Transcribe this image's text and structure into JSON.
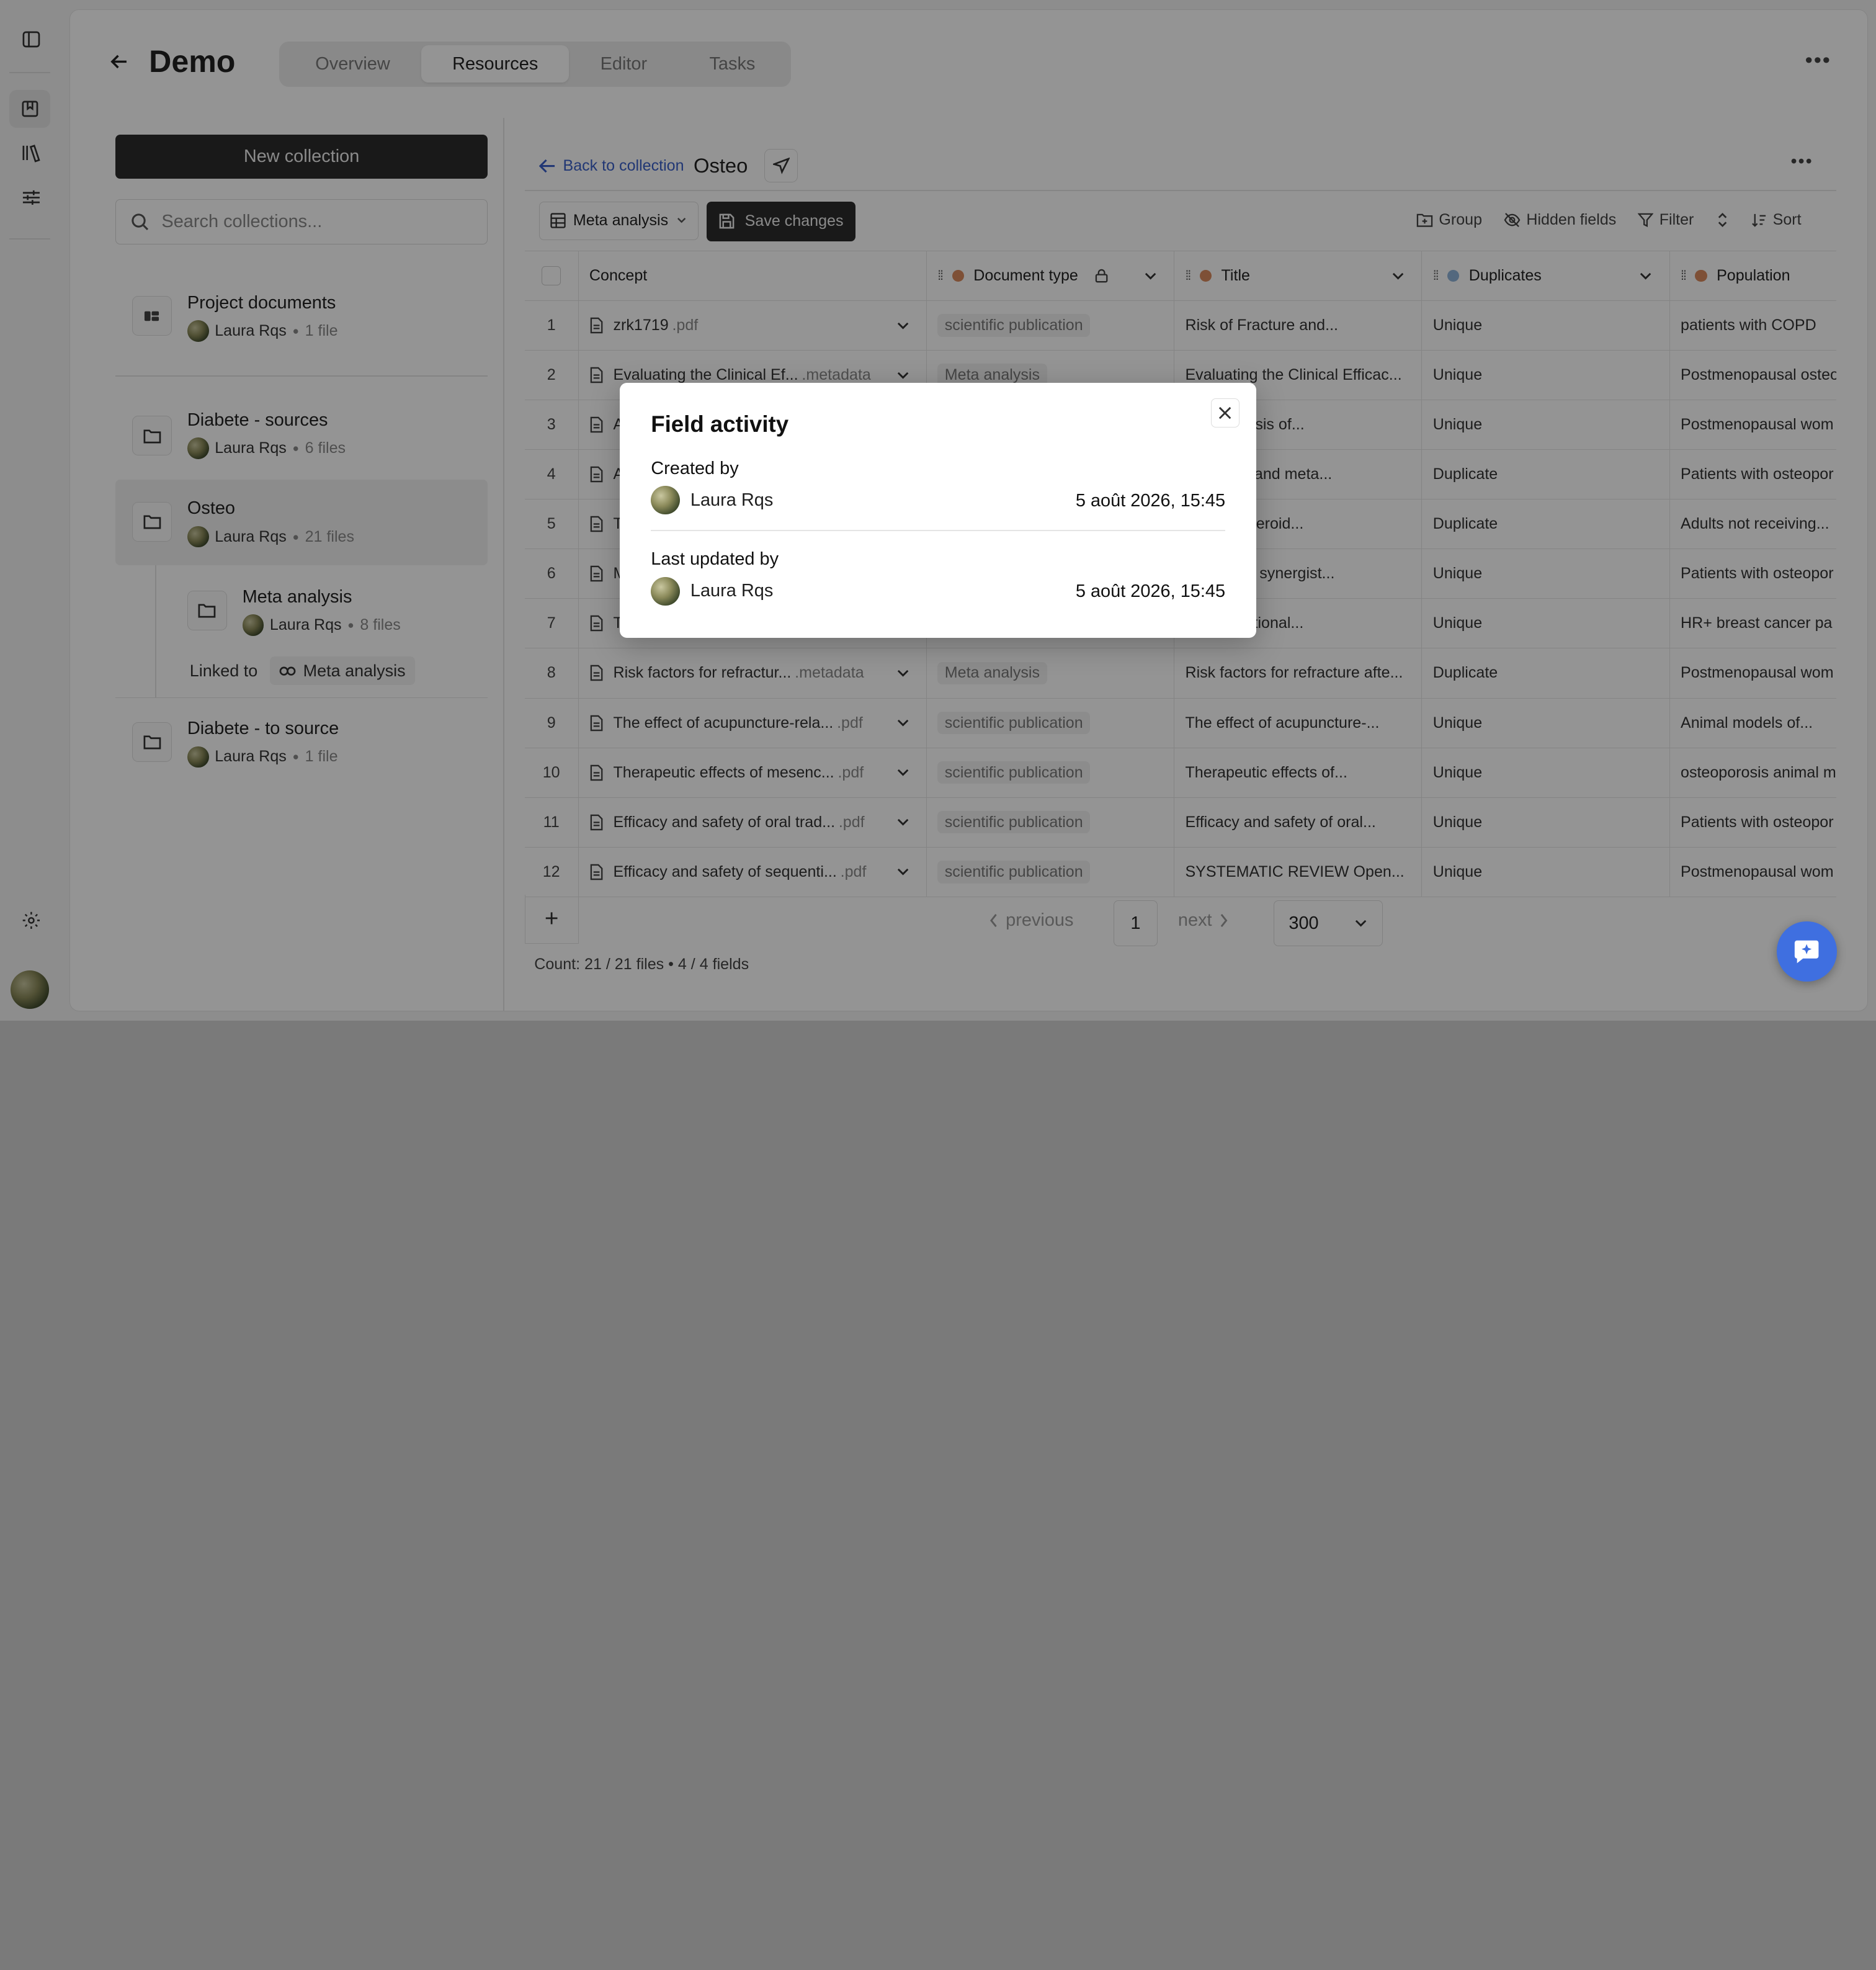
{
  "app": {
    "title": "Demo",
    "back_label": "Back"
  },
  "tabs": [
    {
      "label": "Overview"
    },
    {
      "label": "Resources"
    },
    {
      "label": "Editor"
    },
    {
      "label": "Tasks"
    }
  ],
  "sidebar": {
    "new_collection": "New collection",
    "search_placeholder": "Search collections..."
  },
  "collections": [
    {
      "name": "Project documents",
      "owner": "Laura Rqs",
      "count": "1 file"
    },
    {
      "name": "Diabete - sources",
      "owner": "Laura Rqs",
      "count": "6 files"
    },
    {
      "name": "Osteo",
      "owner": "Laura Rqs",
      "count": "21 files"
    },
    {
      "name": "Meta analysis",
      "owner": "Laura Rqs",
      "count": "8 files"
    },
    {
      "name": "Diabete - to source",
      "owner": "Laura Rqs",
      "count": "1 file"
    }
  ],
  "linked": {
    "label": "Linked to",
    "target": "Meta analysis"
  },
  "content": {
    "back_to_collection": "Back to collection",
    "collection_name": "Osteo",
    "view_select": "Meta analysis",
    "save_changes": "Save changes",
    "toolbar": {
      "group": "Group",
      "hidden_fields": "Hidden fields",
      "filter": "Filter",
      "sort": "Sort"
    }
  },
  "table": {
    "headers": {
      "concept": "Concept",
      "document_type": "Document type",
      "title": "Title",
      "duplicates": "Duplicates",
      "population": "Population"
    },
    "header_colors": {
      "document_type": "#d98a5e",
      "title": "#d98a5e",
      "duplicates": "#8fb3d9",
      "population": "#d98a5e"
    },
    "rows": [
      {
        "n": "1",
        "concept": "zrk1719",
        "ext": ".pdf",
        "doctype": "scientific publication",
        "title": "Risk of Fracture and...",
        "dup": "Unique",
        "pop": "patients with COPD"
      },
      {
        "n": "2",
        "concept": "Evaluating the Clinical Ef...",
        "ext": ".metadata",
        "doctype": "Meta analysis",
        "title": "Evaluating the Clinical Efficac...",
        "dup": "Unique",
        "pop": "Postmenopausal osteo"
      },
      {
        "n": "3",
        "concept": "A",
        "ext": "",
        "doctype": "",
        "title": "ving analysis of...",
        "dup": "Unique",
        "pop": "Postmenopausal wom"
      },
      {
        "n": "4",
        "concept": "A",
        "ext": "",
        "doctype": "",
        "title": "tic review and meta...",
        "dup": "Duplicate",
        "pop": "Patients with osteopor"
      },
      {
        "n": "5",
        "concept": "T",
        "ext": "",
        "doctype": "",
        "title": "of pulse steroid...",
        "dup": "Duplicate",
        "pop": "Adults not receiving..."
      },
      {
        "n": "6",
        "concept": "M",
        "ext": "",
        "doctype": "",
        "title": "ysis of the synergist...",
        "dup": "Unique",
        "pop": "Patients with osteopor"
      },
      {
        "n": "7",
        "concept": "T",
        "ext": "",
        "doctype": "",
        "title": "ct of Traditional...",
        "dup": "Unique",
        "pop": "HR+ breast cancer pa"
      },
      {
        "n": "8",
        "concept": "Risk factors for refractur...",
        "ext": ".metadata",
        "doctype": "Meta analysis",
        "title": "Risk factors for refracture afte...",
        "dup": "Duplicate",
        "pop": "Postmenopausal wom"
      },
      {
        "n": "9",
        "concept": "The effect of acupuncture-rela...",
        "ext": ".pdf",
        "doctype": "scientific publication",
        "title": "The effect of acupuncture-...",
        "dup": "Unique",
        "pop": "Animal models of..."
      },
      {
        "n": "10",
        "concept": "Therapeutic effects of mesenc...",
        "ext": ".pdf",
        "doctype": "scientific publication",
        "title": "Therapeutic effects of...",
        "dup": "Unique",
        "pop": "osteoporosis animal m"
      },
      {
        "n": "11",
        "concept": "Efficacy and safety of oral trad...",
        "ext": ".pdf",
        "doctype": "scientific publication",
        "title": "Efficacy and safety of oral...",
        "dup": "Unique",
        "pop": "Patients with osteopor"
      },
      {
        "n": "12",
        "concept": "Efficacy and safety of sequenti...",
        "ext": ".pdf",
        "doctype": "scientific publication",
        "title": "SYSTEMATIC REVIEW Open...",
        "dup": "Unique",
        "pop": "Postmenopausal wom"
      }
    ]
  },
  "pagination": {
    "add": "+",
    "previous": "previous",
    "page": "1",
    "next": "next",
    "page_size": "300"
  },
  "footer": {
    "count": "Count: 21 / 21 files • 4 / 4 fields"
  },
  "modal": {
    "title": "Field activity",
    "created_label": "Created by",
    "created_user": "Laura Rqs",
    "created_date": "5 août 2026, 15:45",
    "updated_label": "Last updated by",
    "updated_user": "Laura Rqs",
    "updated_date": "5 août 2026, 15:45"
  }
}
